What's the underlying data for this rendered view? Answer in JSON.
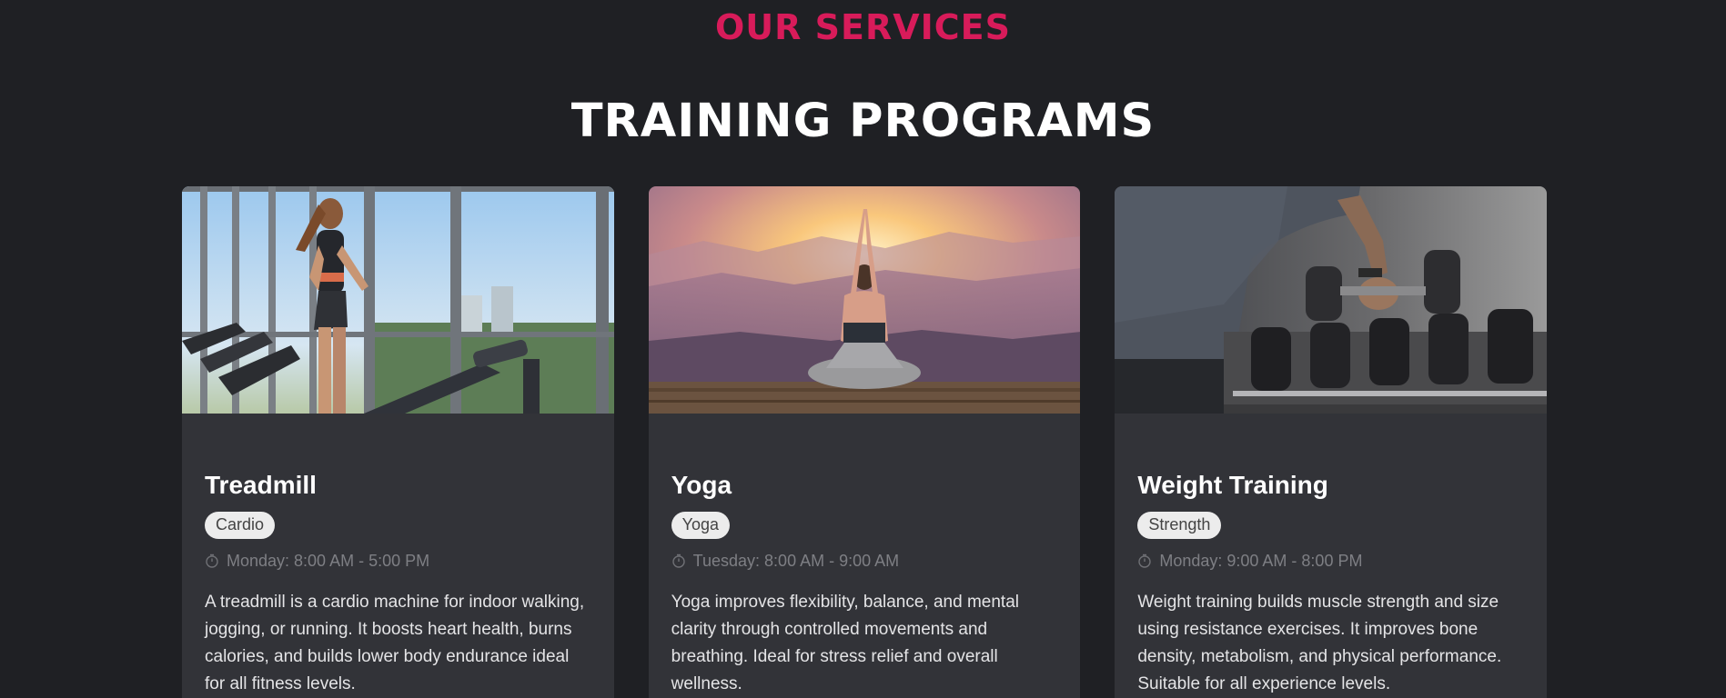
{
  "section": {
    "eyebrow": "OUR SERVICES",
    "heading": "TRAINING PROGRAMS"
  },
  "colors": {
    "accent": "#d81b5a",
    "background": "#1f2024",
    "card": "#323338"
  },
  "cards": [
    {
      "title": "Treadmill",
      "tag": "Cardio",
      "schedule": "Monday: 8:00 AM - 5:00 PM",
      "description": "A treadmill is a cardio machine for indoor walking, jogging, or running. It boosts heart health, burns calories, and builds lower body endurance ideal for all fitness levels.",
      "image": "woman running on treadmill by window"
    },
    {
      "title": "Yoga",
      "tag": "Yoga",
      "schedule": "Tuesday: 8:00 AM - 9:00 AM",
      "description": "Yoga improves flexibility, balance, and mental clarity through controlled movements and breathing. Ideal for stress relief and overall wellness.",
      "image": "woman meditating at sunset over mountains"
    },
    {
      "title": "Weight Training",
      "tag": "Strength",
      "schedule": "Monday: 9:00 AM - 8:00 PM",
      "description": "Weight training builds muscle strength and size using resistance exercises. It improves bone density, metabolism, and physical performance. Suitable for all experience levels.",
      "image": "man lifting dumbbell from rack"
    }
  ]
}
